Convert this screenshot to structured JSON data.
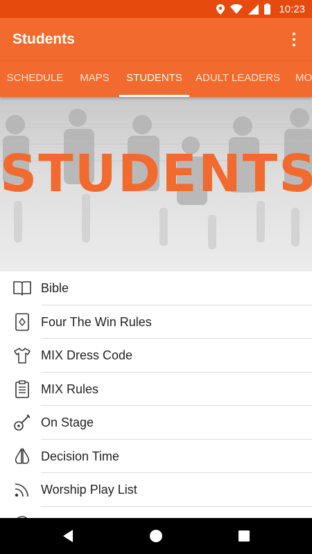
{
  "status": {
    "time": "10:23"
  },
  "app_bar": {
    "title": "Students"
  },
  "tabs": [
    {
      "label": "SCHEDULE",
      "active": false
    },
    {
      "label": "MAPS",
      "active": false
    },
    {
      "label": "STUDENTS",
      "active": true
    },
    {
      "label": "ADULT LEADERS",
      "active": false
    },
    {
      "label": "MO",
      "active": false
    }
  ],
  "hero": {
    "title": "STUDENTS"
  },
  "list": [
    {
      "label": "Bible",
      "icon": "book-icon"
    },
    {
      "label": "Four The Win Rules",
      "icon": "playing-card-icon"
    },
    {
      "label": "MIX Dress Code",
      "icon": "shirt-icon"
    },
    {
      "label": "MIX Rules",
      "icon": "clipboard-icon"
    },
    {
      "label": "On Stage",
      "icon": "guitar-icon"
    },
    {
      "label": "Decision Time",
      "icon": "praying-hands-icon"
    },
    {
      "label": "Worship Play List",
      "icon": "rss-icon"
    }
  ],
  "colors": {
    "status_bar": "#e64a0d",
    "primary": "#f26a2d",
    "nav_bar": "#000000"
  }
}
